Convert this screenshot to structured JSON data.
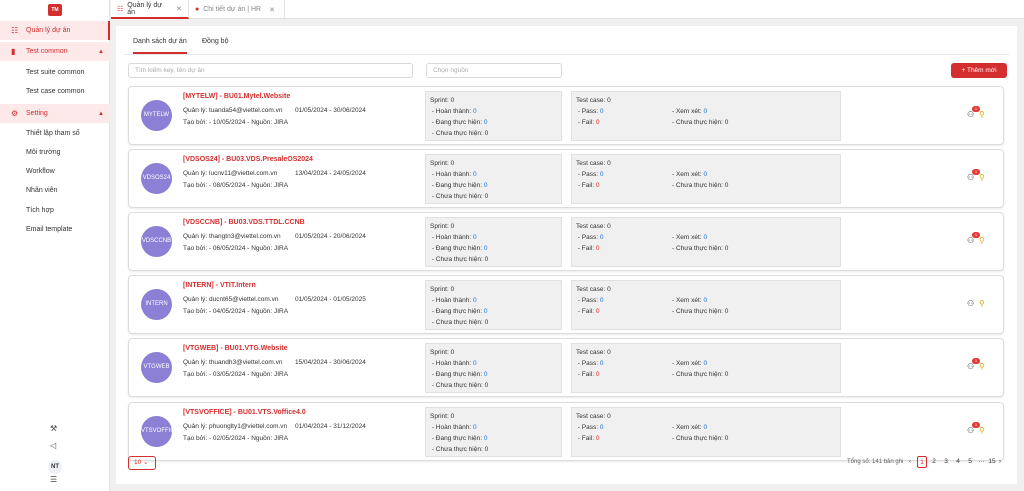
{
  "app": {
    "logo": "TM"
  },
  "sidebar": {
    "items": [
      {
        "label": "Quản lý dự án"
      },
      {
        "label": "Test common"
      },
      {
        "label": "Setting"
      }
    ],
    "test_common_sub": [
      "Test suite common",
      "Test case common"
    ],
    "setting_sub": [
      "Thiết lập tham số",
      "Môi trường",
      "Workflow",
      "Nhân viên",
      "Tích hợp",
      "Email template"
    ],
    "user_initials": "NT"
  },
  "tabs": [
    {
      "label": "Quản lý dự án"
    },
    {
      "label": "Chi tiết dự án | HR"
    }
  ],
  "main": {
    "subtabs": [
      "Danh sách dự án",
      "Đồng bộ"
    ],
    "search_placeholder": "Tìm kiếm key, tên dự án",
    "source_placeholder": "Chọn nguồn",
    "add_button": "Thêm mới"
  },
  "labels": {
    "sprint": "Sprint: ",
    "done": "- Hoàn thành: ",
    "doing": "- Đang thực hiện: ",
    "todo": "- Chưa thực hiện: ",
    "testcase": "Test case: ",
    "pass": "- Pass: ",
    "fail": "- Fail: ",
    "review": "- Xem xét: ",
    "tc_todo": "- Chưa thực hiện: "
  },
  "projects": [
    {
      "avatar": "MYTELW",
      "title": "[MYTELW] - BU01.Mytel.Website",
      "manager": "Quản lý: tuanda54@viettel.com.vn",
      "dates": "01/05/2024 - 30/06/2024",
      "created": "Tạo bởi: - 10/05/2024 - Nguồn: JIRA",
      "sprint": "0",
      "done": "0",
      "doing": "0",
      "todo": "0",
      "tc": "0",
      "pass": "0",
      "fail": "0",
      "review": "0",
      "tc_todo": "0",
      "badge": "1"
    },
    {
      "avatar": "VDSOS24",
      "title": "[VDSOS24] - BU03.VDS.PresaleOS2024",
      "manager": "Quản lý: lucnv11@viettel.com.vn",
      "dates": "13/04/2024 - 24/05/2024",
      "created": "Tạo bởi: - 08/05/2024 - Nguồn: JIRA",
      "sprint": "0",
      "done": "0",
      "doing": "0",
      "todo": "0",
      "tc": "0",
      "pass": "0",
      "fail": "0",
      "review": "0",
      "tc_todo": "0",
      "badge": "1"
    },
    {
      "avatar": "VDSCCNB",
      "title": "[VDSCCNB] - BU03.VDS.TTDL.CCNB",
      "manager": "Quản lý: thangtn3@viettel.com.vn",
      "dates": "01/05/2024 - 20/06/2024",
      "created": "Tạo bởi: - 06/05/2024 - Nguồn: JIRA",
      "sprint": "0",
      "done": "0",
      "doing": "0",
      "todo": "0",
      "tc": "0",
      "pass": "0",
      "fail": "0",
      "review": "0",
      "tc_todo": "0",
      "badge": "1"
    },
    {
      "avatar": "INTERN",
      "title": "[INTERN] - VTIT.Intern",
      "manager": "Quản lý: ducnt65@viettel.com.vn",
      "dates": "01/05/2024 - 01/05/2025",
      "created": "Tạo bởi: - 04/05/2024 - Nguồn: JIRA",
      "sprint": "0",
      "done": "0",
      "doing": "0",
      "todo": "0",
      "tc": "0",
      "pass": "0",
      "fail": "0",
      "review": "0",
      "tc_todo": "0",
      "badge": ""
    },
    {
      "avatar": "VTGWEB",
      "title": "[VTGWEB] - BU01.VTG.Website",
      "manager": "Quản lý: thuandh3@viettel.com.vn",
      "dates": "15/04/2024 - 30/06/2024",
      "created": "Tạo bởi: - 03/05/2024 - Nguồn: JIRA",
      "sprint": "0",
      "done": "0",
      "doing": "0",
      "todo": "0",
      "tc": "0",
      "pass": "0",
      "fail": "0",
      "review": "0",
      "tc_todo": "0",
      "badge": "1"
    },
    {
      "avatar": "VTSVOFFICE",
      "title": "[VTSVOFFICE] - BU01.VTS.Voffice4.0",
      "manager": "Quản lý: phuonglty1@viettel.com.vn",
      "dates": "01/04/2024 - 31/12/2024",
      "created": "Tạo bởi: - 02/05/2024 - Nguồn: JIRA",
      "sprint": "0",
      "done": "0",
      "doing": "0",
      "todo": "0",
      "tc": "0",
      "pass": "0",
      "fail": "0",
      "review": "0",
      "tc_todo": "0",
      "badge": "1"
    }
  ],
  "pagination": {
    "page_size": "10",
    "total": "Tổng số: 141 bản ghi",
    "pages": [
      "1",
      "2",
      "3",
      "4",
      "5",
      "···",
      "15"
    ],
    "current": "1"
  },
  "colors": {
    "accent": "#d32f2f",
    "avatar": "#8b7fd6",
    "link": "#1976d2"
  }
}
